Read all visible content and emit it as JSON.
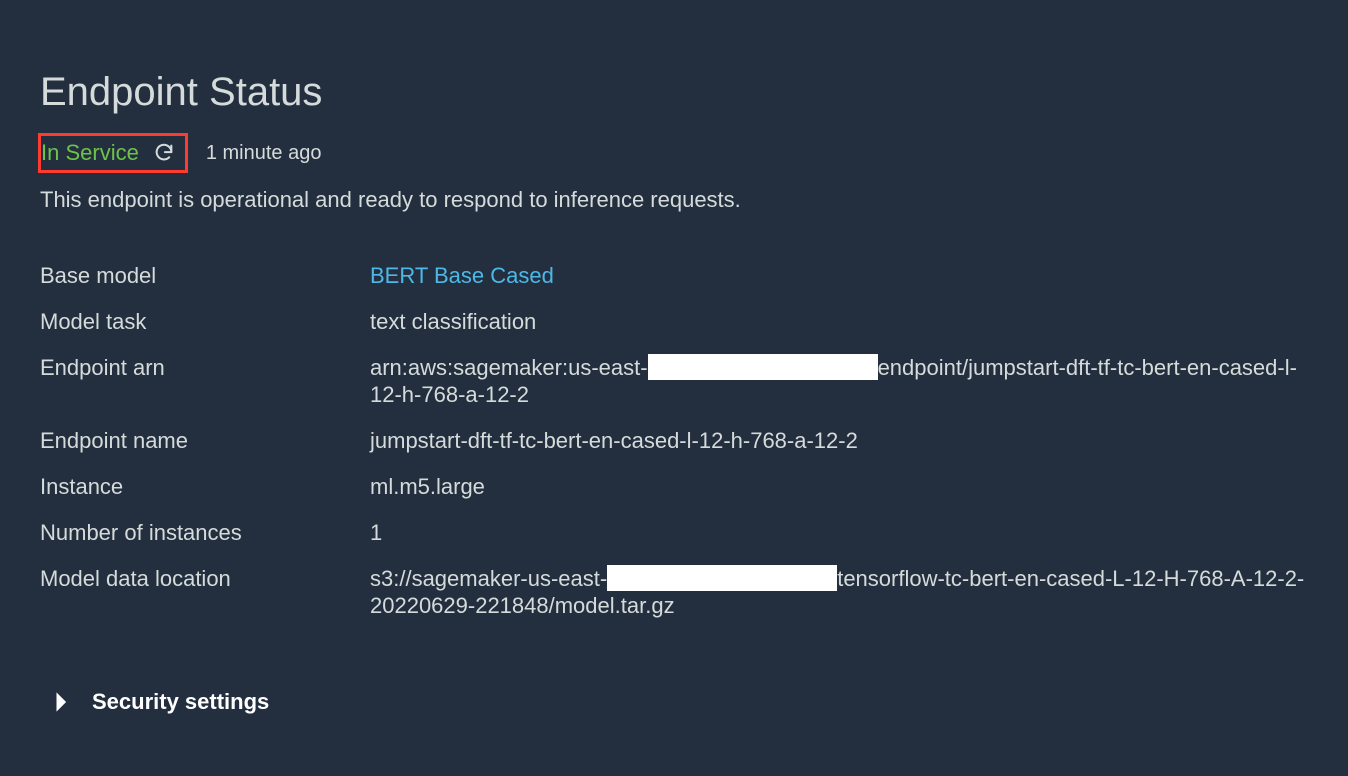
{
  "header": {
    "title": "Endpoint Status",
    "status": "In Service",
    "timestamp": "1 minute ago",
    "description": "This endpoint is operational and ready to respond to inference requests."
  },
  "details": {
    "base_model_label": "Base model",
    "base_model_value": "BERT Base Cased",
    "model_task_label": "Model task",
    "model_task_value": "text classification",
    "endpoint_arn_label": "Endpoint arn",
    "endpoint_arn_prefix": "arn:aws:sagemaker:us-east-",
    "endpoint_arn_suffix": "endpoint/jumpstart-dft-tf-tc-bert-en-cased-l-12-h-768-a-12-2",
    "endpoint_name_label": "Endpoint name",
    "endpoint_name_value": "jumpstart-dft-tf-tc-bert-en-cased-l-12-h-768-a-12-2",
    "instance_label": "Instance",
    "instance_value": "ml.m5.large",
    "num_instances_label": "Number of instances",
    "num_instances_value": "1",
    "model_data_label": "Model data location",
    "model_data_prefix": "s3://sagemaker-us-east-",
    "model_data_suffix": "tensorflow-tc-bert-en-cased-L-12-H-768-A-12-2-20220629-221848/model.tar.gz"
  },
  "footer": {
    "security_settings": "Security settings"
  }
}
